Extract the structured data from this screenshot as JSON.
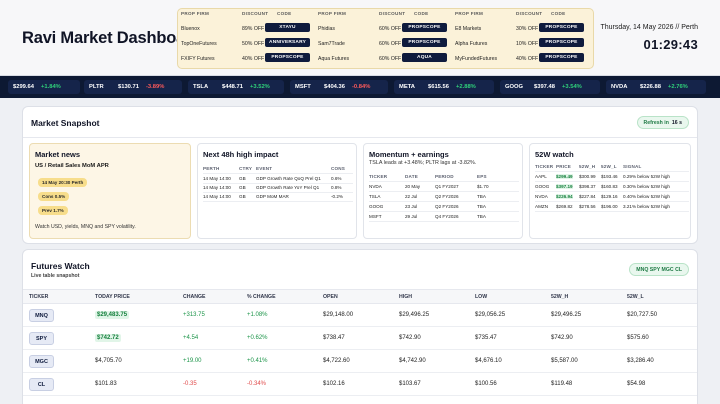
{
  "app": {
    "title": "Ravi Market Dashboard"
  },
  "clock": {
    "date": "Thursday, 14 May 2026 // Perth",
    "time": "01:29:43"
  },
  "promos": {
    "headers": {
      "firm": "PROP FIRM",
      "discount": "DISCOUNT",
      "code": "CODE"
    },
    "columns": [
      [
        {
          "firm": "Bluenox",
          "discount": "89% OFF",
          "code": "XTAYU"
        },
        {
          "firm": "TopOneFutures",
          "discount": "50% OFF",
          "code": "ANNIVERSARY"
        },
        {
          "firm": "FXIFY Futures",
          "discount": "40% OFF",
          "code": "PROPSCOPE"
        }
      ],
      [
        {
          "firm": "Phidias",
          "discount": "60% OFF",
          "code": "PROPSCOPE"
        },
        {
          "firm": "Sam7Trade",
          "discount": "60% OFF",
          "code": "PROPSCOPE"
        },
        {
          "firm": "Aqua Futures",
          "discount": "60% OFF",
          "code": "AQUA"
        }
      ],
      [
        {
          "firm": "E8 Markets",
          "discount": "30% OFF",
          "code": "PROPSCOPE"
        },
        {
          "firm": "Alpha Futures",
          "discount": "10% OFF",
          "code": "PROPSCOPE"
        },
        {
          "firm": "MyFundedFutures",
          "discount": "40% OFF",
          "code": "PROPSCOPE"
        }
      ]
    ]
  },
  "ticker": [
    {
      "sym": "",
      "price": "$299.64",
      "chg": "+1.84%",
      "dir": "pos"
    },
    {
      "sym": "PLTR",
      "price": "$130.71",
      "chg": "-3.89%",
      "dir": "neg"
    },
    {
      "sym": "TSLA",
      "price": "$448.71",
      "chg": "+3.52%",
      "dir": "pos"
    },
    {
      "sym": "MSFT",
      "price": "$404.36",
      "chg": "-0.84%",
      "dir": "neg"
    },
    {
      "sym": "META",
      "price": "$615.56",
      "chg": "+2.88%",
      "dir": "pos"
    },
    {
      "sym": "GOOG",
      "price": "$397.48",
      "chg": "+3.54%",
      "dir": "pos"
    },
    {
      "sym": "NVDA",
      "price": "$226.88",
      "chg": "+2.76%",
      "dir": "pos"
    }
  ],
  "snapshot": {
    "title": "Market Snapshot",
    "refresh_label": "Refresh in",
    "refresh_value": "16 s",
    "news": {
      "title": "Market news",
      "headline": "US / Retail Sales MoM APR",
      "time": "14 May 20:30 Perth",
      "cons": "Cons 0.5%",
      "prev": "Prev 1.7%",
      "note": "Watch USD, yields, MNQ and SPY volatility."
    },
    "high_impact": {
      "title": "Next 48h high impact",
      "headers": [
        "PERTH",
        "CTRY",
        "EVENT",
        "CONS"
      ],
      "rows": [
        [
          "14 May 14:00",
          "GB",
          "GDP Growth Rate QoQ Prel Q1",
          "0.6%"
        ],
        [
          "14 May 14:00",
          "GB",
          "GDP Growth Rate YoY Prel Q1",
          "0.8%"
        ],
        [
          "14 May 14:00",
          "GB",
          "GDP MoM MAR",
          "-0.2%"
        ]
      ]
    },
    "momentum": {
      "title": "Momentum + earnings",
      "subtitle": "TSLA leads at +3.48%; PLTR lags at -3.82%.",
      "headers": [
        "TICKER",
        "DATE",
        "PERIOD",
        "EPS"
      ],
      "rows": [
        [
          "NVDA",
          "20 May",
          "Q1 FY2027",
          "$1.70"
        ],
        [
          "TSLA",
          "22 Jul",
          "Q2 FY2026",
          "TBA"
        ],
        [
          "GOOG",
          "23 Jul",
          "Q2 FY2026",
          "TBA"
        ],
        [
          "MSFT",
          "29 Jul",
          "Q4 FY2026",
          "TBA"
        ]
      ]
    },
    "w52": {
      "title": "52W watch",
      "headers": [
        "TICKER",
        "PRICE",
        "52W_H",
        "52W_L",
        "SIGNAL"
      ],
      "rows": [
        [
          "AAPL",
          "$299.49",
          "$300.99",
          "$193.46",
          "0.29% below 52W high"
        ],
        [
          "GOOG",
          "$397.19",
          "$398.37",
          "$160.83",
          "0.30% below 52W high"
        ],
        [
          "NVDA",
          "$226.94",
          "$227.84",
          "$129.16",
          "0.40% below 52W high"
        ],
        [
          "AMZN",
          "$269.82",
          "$278.56",
          "$196.00",
          "3.21% below 52W high"
        ]
      ]
    }
  },
  "futures": {
    "title": "Futures Watch",
    "subtitle": "Live table snapshot",
    "pill": "MNQ SPY MGC CL",
    "headers": [
      "TICKER",
      "TODAY PRICE",
      "CHANGE",
      "% CHANGE",
      "OPEN",
      "HIGH",
      "LOW",
      "52W_H",
      "52W_L"
    ],
    "rows": [
      {
        "ticker": "MNQ",
        "price": "$29,483.75",
        "price_up": true,
        "change": "+313.75",
        "pct": "+1.08%",
        "dir": "pos",
        "open": "$29,148.00",
        "high": "$29,496.25",
        "low": "$29,056.25",
        "h52": "$29,496.25",
        "l52": "$20,727.50"
      },
      {
        "ticker": "SPY",
        "price": "$742.72",
        "price_up": true,
        "change": "+4.54",
        "pct": "+0.62%",
        "dir": "pos",
        "open": "$738.47",
        "high": "$742.90",
        "low": "$735.47",
        "h52": "$742.90",
        "l52": "$575.60"
      },
      {
        "ticker": "MGC",
        "price": "$4,705.70",
        "price_up": false,
        "change": "+19.00",
        "pct": "+0.41%",
        "dir": "pos",
        "open": "$4,722.60",
        "high": "$4,742.90",
        "low": "$4,676.10",
        "h52": "$5,587.00",
        "l52": "$3,286.40"
      },
      {
        "ticker": "CL",
        "price": "$101.83",
        "price_up": false,
        "change": "-0.35",
        "pct": "-0.34%",
        "dir": "neg",
        "open": "$102.16",
        "high": "$103.67",
        "low": "$100.56",
        "h52": "$119.48",
        "l52": "$54.98"
      }
    ]
  },
  "colors": {
    "navy": "#0d1933",
    "accent_green": "#1b9448",
    "accent_red": "#e04b4b",
    "promo_bg": "#fbf2d9"
  }
}
